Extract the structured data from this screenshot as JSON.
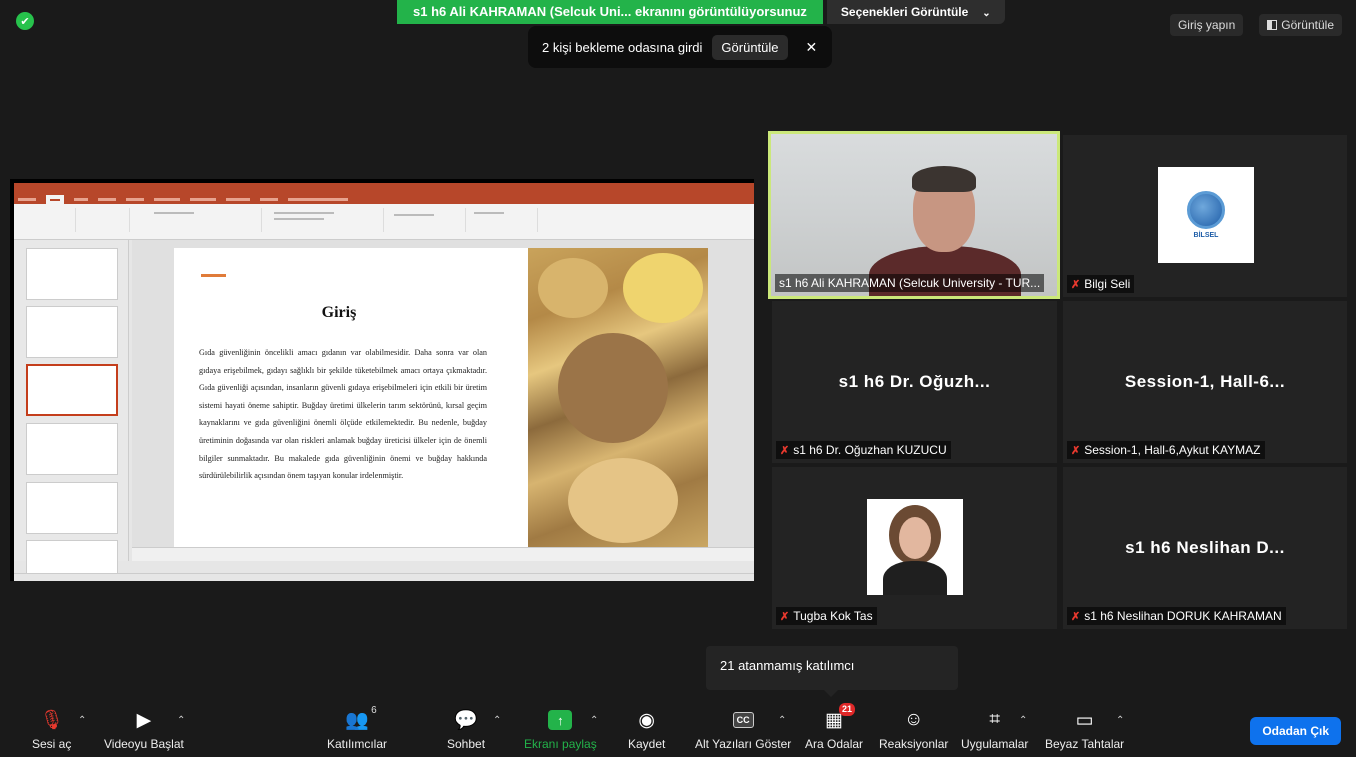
{
  "top": {
    "share_banner": "s1 h6 Ali KAHRAMAN (Selcuk Uni... ekranını görüntülüyorsunuz",
    "view_options": "Seçenekleri Görüntüle",
    "waiting_msg": "2 kişi bekleme odasına girdi",
    "waiting_button": "Görüntüle",
    "signin": "Giriş yapın",
    "view": "Görüntüle"
  },
  "slide": {
    "title": "Giriş",
    "body": "Gıda güvenliğinin öncelikli amacı gıdanın var olabilmesidir. Daha sonra var olan gıdaya erişebilmek, gıdayı sağlıklı bir şekilde tüketebilmek amacı ortaya çıkmaktadır. Gıda güvenliği açısından, insanların güvenli gıdaya erişebilmeleri için etkili bir üretim sistemi hayati öneme sahiptir. Buğday üretimi ülkelerin tarım sektörünü, kırsal geçim kaynaklarını ve gıda güvenliğini önemli ölçüde etkilemektedir. Bu nedenle, buğday üretiminin doğasında var olan riskleri anlamak buğday üreticisi ülkeler için de önemli bilgiler sunmaktadır. Bu makalede gıda güvenliğinin önemi ve buğday hakkında sürdürülebilirlik açısından önem taşıyan konular irdelenmiştir."
  },
  "participants": [
    {
      "name": "s1 h6 Ali KAHRAMAN (Selcuk University - TUR...",
      "muted": false
    },
    {
      "name": "Bilgi Seli",
      "muted": true
    },
    {
      "name": "s1 h6 Dr. Oğuzhan KUZUCU",
      "big": "s1 h6 Dr. Oğuzh...",
      "muted": true
    },
    {
      "name": "Session-1, Hall-6,Aykut KAYMAZ",
      "big": "Session-1,  Hall-6...",
      "muted": true
    },
    {
      "name": "Tugba Kok Tas",
      "muted": true
    },
    {
      "name": "s1 h6 Neslihan DORUK KAHRAMAN",
      "big": "s1 h6 Neslihan D...",
      "muted": true
    }
  ],
  "logo_text": "BİLSEL",
  "popup": "21 atanmamış katılımcı",
  "toolbar": {
    "unmute": "Sesi aç",
    "start_video": "Videoyu Başlat",
    "participants": "Katılımcılar",
    "participants_count": "6",
    "chat": "Sohbet",
    "share": "Ekranı paylaş",
    "record": "Kaydet",
    "captions": "Alt Yazıları Göster",
    "captions_icon": "CC",
    "breakout": "Ara Odalar",
    "breakout_badge": "21",
    "reactions": "Reaksiyonlar",
    "apps": "Uygulamalar",
    "whiteboard": "Beyaz Tahtalar",
    "leave": "Odadan Çık"
  },
  "colors": {
    "share_green": "#23b34a",
    "leave_blue": "#0e72ed",
    "active_border": "#cbe87a",
    "mute_red": "#e8392e"
  }
}
